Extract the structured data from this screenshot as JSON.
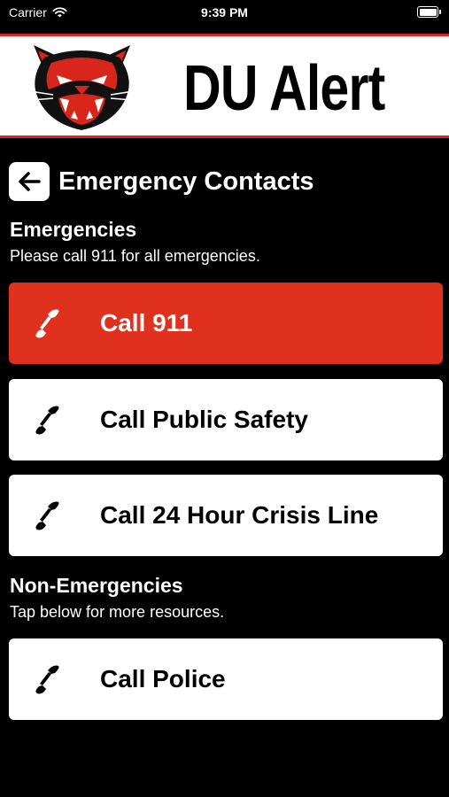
{
  "status_bar": {
    "carrier": "Carrier",
    "time": "9:39 PM"
  },
  "banner": {
    "title": "DU Alert",
    "logo_icon": "panther-logo"
  },
  "header": {
    "back_icon": "arrow-left-icon",
    "title": "Emergency Contacts"
  },
  "emergencies": {
    "title": "Emergencies",
    "subtitle": "Please call 911 for all emergencies.",
    "buttons": [
      {
        "label": "Call 911",
        "style": "primary"
      },
      {
        "label": "Call Public Safety",
        "style": "default"
      },
      {
        "label": "Call 24 Hour Crisis Line",
        "style": "default"
      }
    ]
  },
  "non_emergencies": {
    "title": "Non-Emergencies",
    "subtitle": "Tap below for more resources.",
    "buttons": [
      {
        "label": "Call Police",
        "style": "default"
      }
    ]
  },
  "colors": {
    "accent": "#e0301e",
    "background": "#000000",
    "card": "#ffffff"
  }
}
